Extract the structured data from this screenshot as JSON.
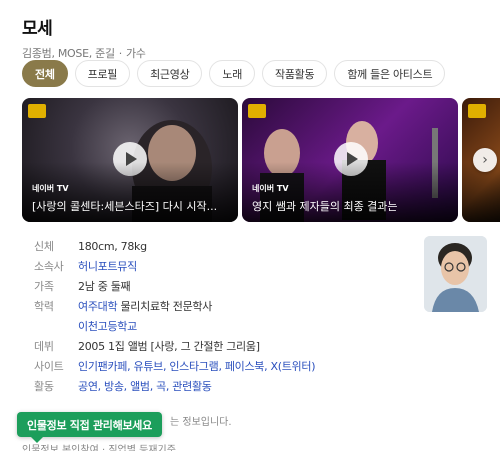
{
  "person": {
    "name": "모세",
    "related": "김종범, MOSE, 준길",
    "separator": "·",
    "occupation": "가수"
  },
  "tabs": [
    {
      "label": "전체",
      "active": true
    },
    {
      "label": "프로필",
      "active": false
    },
    {
      "label": "최근영상",
      "active": false
    },
    {
      "label": "노래",
      "active": false
    },
    {
      "label": "작품활동",
      "active": false
    },
    {
      "label": "함께 들은 아티스트",
      "active": false
    }
  ],
  "videos": [
    {
      "source": "네이버 TV",
      "title": "[사랑의 콜센타:세븐스타즈] 다시 시작..."
    },
    {
      "source": "네이버 TV",
      "title": "영지 쌤과 제자들의 최종 결과는"
    },
    {
      "source": "",
      "title": ""
    }
  ],
  "profile": {
    "height_weight_label": "신체",
    "height_weight": "180cm, 78kg",
    "agency_label": "소속사",
    "agency": "허니포트뮤직",
    "family_label": "가족",
    "family": "2남 중 둘째",
    "education_label": "학력",
    "education_1_school": "여주대학",
    "education_1_detail": "물리치료학 전문학사",
    "education_2_school": "이천고등학교",
    "debut_label": "데뷔",
    "debut": "2005 1집 앨범 [사랑, 그 간절한 그리움]",
    "site_label": "사이트",
    "sites": "인기팬카페, 유튜브, 인스타그램, 페이스북, X(트위터)",
    "activity_label": "활동",
    "activities": "공연, 방송, 앨범, 곡, 관련활동"
  },
  "footer": {
    "note": "는 정보입니다.",
    "links": "인물정보 본인참여 · 직업별 등재기준",
    "manage_button": "인물정보 직접 관리해보세요"
  },
  "colors": {
    "active_tab": "#8a7a4a",
    "link": "#2a4fbd",
    "manage_button": "#1c9e5b"
  }
}
